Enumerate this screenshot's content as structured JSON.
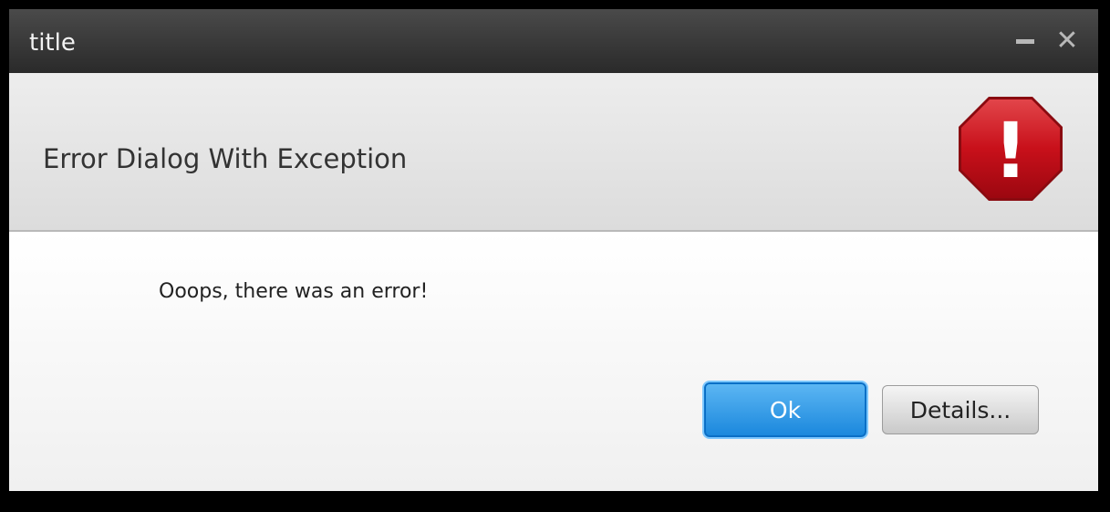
{
  "window": {
    "title": "title",
    "minimize_icon": "minimize-icon",
    "close_icon": "close-icon",
    "close_glyph": "✕"
  },
  "header": {
    "text": "Error Dialog With Exception",
    "icon": "error-stop-icon",
    "icon_glyph": "!"
  },
  "content": {
    "message": "Ooops, there was an error!"
  },
  "buttons": {
    "ok_label": "Ok",
    "details_label": "Details..."
  },
  "colors": {
    "titlebar": "#2f2f2f",
    "accent": "#1b88dd",
    "error_red": "#c8101a"
  }
}
